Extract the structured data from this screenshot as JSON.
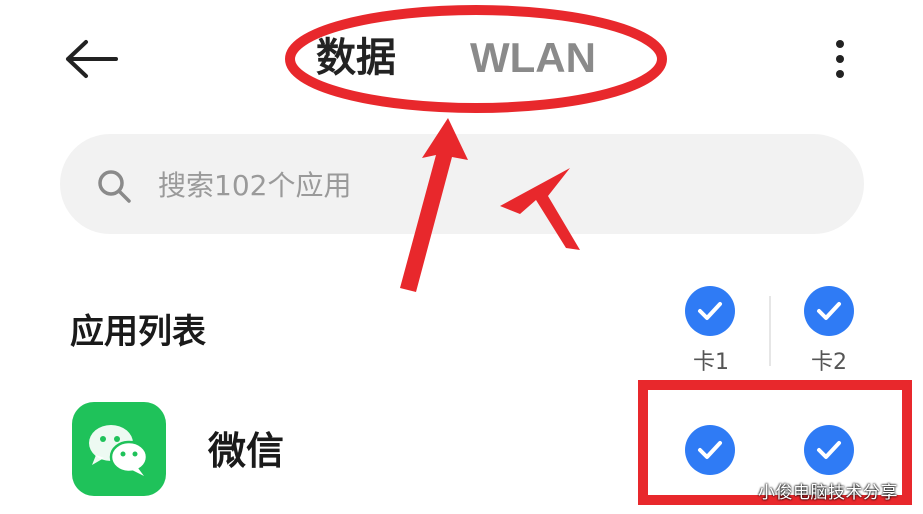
{
  "header": {
    "back_icon": "arrow-left-icon",
    "tabs": [
      {
        "label": "数据",
        "active": true
      },
      {
        "label": "WLAN",
        "active": false
      }
    ],
    "more_icon": "more-vertical-icon"
  },
  "search": {
    "icon": "search-icon",
    "placeholder": "搜索102个应用"
  },
  "list": {
    "title": "应用列表",
    "columns": [
      {
        "label": "卡1",
        "checked": true
      },
      {
        "label": "卡2",
        "checked": true
      }
    ],
    "apps": [
      {
        "name": "微信",
        "icon": "wechat-icon",
        "sim1": true,
        "sim2": true
      }
    ]
  },
  "colors": {
    "accent": "#2f7bf5",
    "wechat": "#1fc25a",
    "annotation": "#e8282c"
  },
  "watermark": "小俊电脑技术分享"
}
